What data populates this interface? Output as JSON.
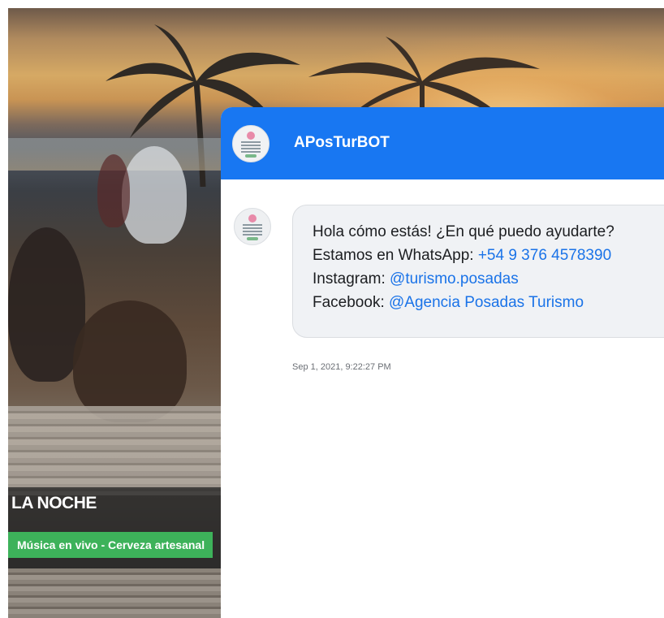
{
  "promo": {
    "title": "LA NOCHE",
    "tag": "Música en vivo - Cerveza artesanal"
  },
  "chat": {
    "bot_name": "APosTurBOT",
    "header_color": "#1877f2",
    "message": {
      "greeting": "Hola cómo estás! ¿En qué puedo ayudarte?",
      "whatsapp_label": "Estamos en WhatsApp: ",
      "whatsapp_value": "+54 9 376 4578390",
      "instagram_label": "Instagram: ",
      "instagram_value": "@turismo.posadas",
      "facebook_label": "Facebook: ",
      "facebook_value": "@Agencia Posadas Turismo",
      "timestamp": "Sep 1, 2021, 9:22:27 PM"
    }
  }
}
